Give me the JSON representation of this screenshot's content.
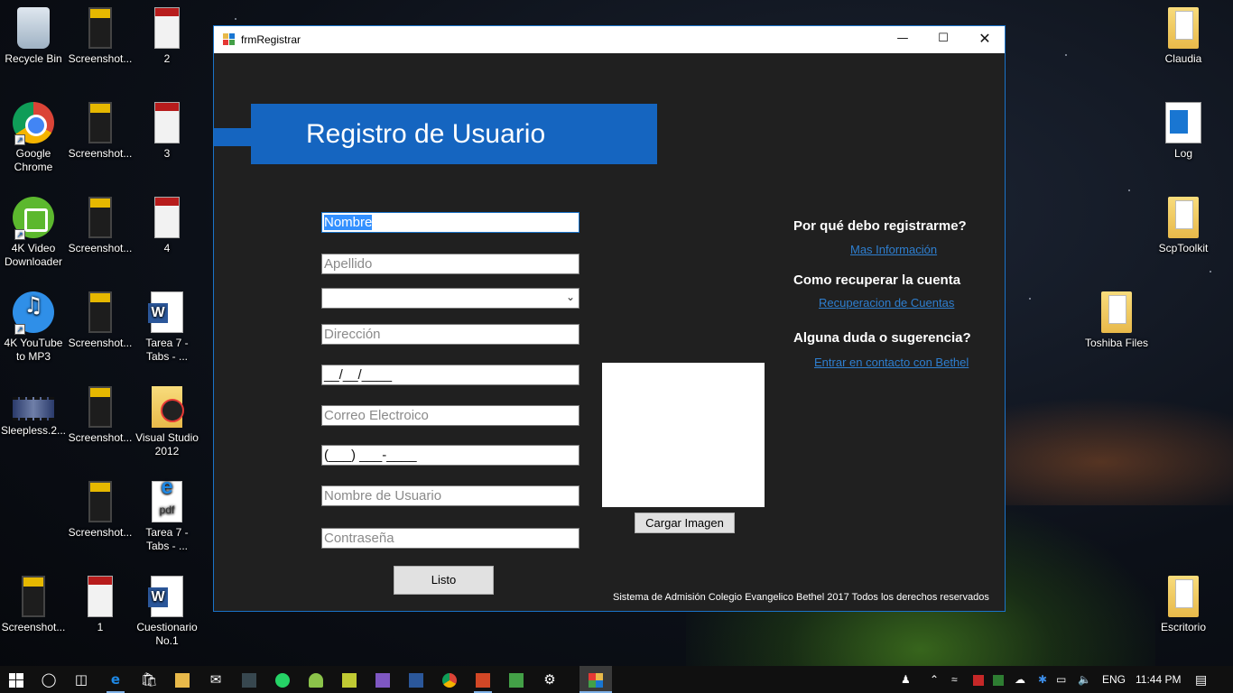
{
  "desktop": {
    "left_icons": [
      {
        "label": "Recycle Bin",
        "icon": "recycle-bin-icon"
      },
      {
        "label": "Screenshot...",
        "icon": "phone-screenshot-icon"
      },
      {
        "label": "2",
        "icon": "red-document-icon"
      },
      {
        "label": "Google\nChrome",
        "icon": "chrome-icon"
      },
      {
        "label": "Screenshot...",
        "icon": "phone-screenshot-icon"
      },
      {
        "label": "3",
        "icon": "red-document-icon"
      },
      {
        "label": "4K Video\nDownloader",
        "icon": "4k-video-downloader-icon"
      },
      {
        "label": "Screenshot...",
        "icon": "phone-screenshot-icon"
      },
      {
        "label": "4",
        "icon": "red-document-icon"
      },
      {
        "label": "4K YouTube\nto MP3",
        "icon": "4k-youtube-mp3-icon"
      },
      {
        "label": "Screenshot...",
        "icon": "phone-screenshot-icon"
      },
      {
        "label": "Tarea 7 -\nTabs - ...",
        "icon": "word-document-icon"
      },
      {
        "label": "Sleepless.2...",
        "icon": "video-file-icon"
      },
      {
        "label": "Screenshot...",
        "icon": "phone-screenshot-icon"
      },
      {
        "label": "Visual Studio\n2012",
        "icon": "json-folder-icon"
      },
      {
        "label": "Screenshot...",
        "icon": "phone-screenshot-icon"
      },
      {
        "label": "Tarea 7 -\nTabs - ...",
        "icon": "edge-pdf-icon"
      },
      {
        "label": "Screenshot...",
        "icon": "phone-screenshot-icon"
      },
      {
        "label": "1",
        "icon": "red-document-icon"
      },
      {
        "label": "Cuestionario\nNo.1",
        "icon": "word-document-icon"
      }
    ],
    "right_icons": [
      {
        "label": "Claudia",
        "icon": "folder-icon"
      },
      {
        "label": "Log",
        "icon": "log-file-icon"
      },
      {
        "label": "ScpToolkit",
        "icon": "folder-icon"
      },
      {
        "label": "Toshiba Files",
        "icon": "folder-icon"
      },
      {
        "label": "Escritorio",
        "icon": "folder-icon"
      }
    ]
  },
  "window": {
    "title": "frmRegistrar",
    "banner_title": "Registro de Usuario",
    "form": {
      "nombre": "Nombre",
      "apellido": "Apellido",
      "combo_value": "",
      "direccion": "Dirección",
      "fecha_mask": "__/__/____",
      "correo": "Correo Electroico",
      "telefono_mask": "(___) ___-____",
      "usuario": "Nombre de Usuario",
      "contrasena": "Contraseña",
      "submit_label": "Listo",
      "load_image_label": "Cargar Imagen"
    },
    "side": {
      "q1": "Por qué debo registrarme?",
      "link1": "Mas Información",
      "q2": "Como recuperar la cuenta",
      "link2": "Recuperacion de Cuentas",
      "q3": "Alguna duda o sugerencia?",
      "link3": "Entrar en contacto con Bethel"
    },
    "footer": "Sistema de Admisión Colegio Evangelico Bethel 2017 Todos los derechos reservados",
    "accent_color": "#1565c0",
    "link_color": "#2e7fd0"
  },
  "taskbar": {
    "language": "ENG",
    "time": "11:44 PM"
  }
}
